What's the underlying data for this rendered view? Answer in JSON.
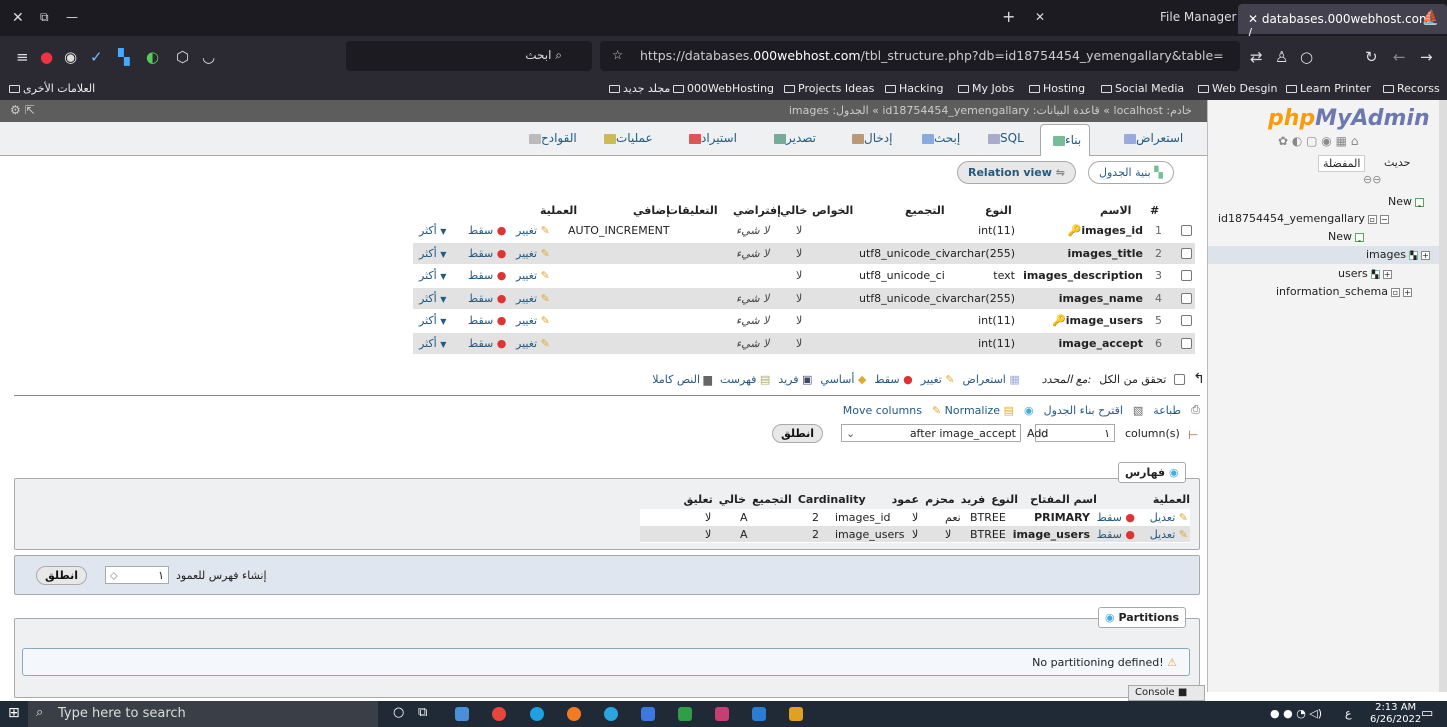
{
  "browser": {
    "active_tab_title": "databases.000webhost.com /",
    "file_manager_tab": "File Manager",
    "url_prefix": "https://databases.",
    "url_domain": "000webhost.com",
    "url_rest": "/tbl_structure.php?db=id18754454_yemengallary&table=",
    "search_placeholder": "ابحث",
    "bookmarks": [
      "مجلد جديد",
      "000WebHosting",
      "Projects Ideas",
      "Hacking",
      "My Jobs",
      "Hosting",
      "Social Media",
      "Web Desgin",
      "Learn Printer",
      "Recorss"
    ],
    "other_bookmarks": "العلامات الأخرى"
  },
  "breadcrumb": "images :الجدول « id18754454_yemengallary :قاعدة البيانات « localhost :خادم",
  "tabs": [
    "استعراض",
    "بناء",
    "SQL",
    "إبحث",
    "إدخال",
    "تصدير",
    "استيراد",
    "عمليات",
    "القوادح"
  ],
  "subtabs": {
    "table_structure": "بنية الجدول",
    "relation_view": "Relation view"
  },
  "sidebar": {
    "logo_php": "php",
    "logo_ma": "MyAdmin",
    "recent": "حديث",
    "favorites": "المفضلة",
    "tree": [
      "New",
      "id18754454_yemengallary",
      "New",
      "images",
      "users",
      "information_schema"
    ]
  },
  "structure": {
    "headers": {
      "num": "#",
      "name": "الاسم",
      "type": "النوع",
      "collation": "التجميع",
      "attributes": "الخواص",
      "null": "خالي",
      "default": "إفتراضي",
      "comments": "التعليقات",
      "extra": "إضافي",
      "action": "العملية"
    },
    "rows": [
      {
        "num": "1",
        "name": "images_id",
        "type": "int(11)",
        "collation": "",
        "null": "لا",
        "default": "لا شيء",
        "extra": "AUTO_INCREMENT"
      },
      {
        "num": "2",
        "name": "images_title",
        "type": "varchar(255)",
        "collation": "utf8_unicode_ci",
        "null": "لا",
        "default": "لا شيء",
        "extra": ""
      },
      {
        "num": "3",
        "name": "images_description",
        "type": "text",
        "collation": "utf8_unicode_ci",
        "null": "لا",
        "default": "",
        "extra": ""
      },
      {
        "num": "4",
        "name": "images_name",
        "type": "varchar(255)",
        "collation": "utf8_unicode_ci",
        "null": "لا",
        "default": "لا شيء",
        "extra": ""
      },
      {
        "num": "5",
        "name": "image_users",
        "type": "int(11)",
        "collation": "",
        "null": "لا",
        "default": "لا شيء",
        "extra": ""
      },
      {
        "num": "6",
        "name": "image_accept",
        "type": "int(11)",
        "collation": "",
        "null": "لا",
        "default": "لا شيء",
        "extra": ""
      }
    ],
    "actions": {
      "edit": "تغيير",
      "drop": "سقط",
      "more": "أكثر"
    }
  },
  "bulk": {
    "check_all": "تحقق من الكل",
    "with_selected": "مع المحدد:",
    "browse": "استعراض",
    "change": "تغيير",
    "drop": "سقط",
    "primary": "أساسي",
    "unique": "فريد",
    "index": "فهرست",
    "fulltext": "النص كاملا"
  },
  "table_tools": {
    "print": "طباعة",
    "propose": "اقترح بناء الجدول",
    "move_columns": "Move columns",
    "normalize": "Normalize",
    "add": "Add",
    "add_count": "١",
    "column_s": "column(s)",
    "after_select": "after image_accept",
    "go": "انطلق"
  },
  "indexes": {
    "legend": "فهارس",
    "headers": {
      "action": "العملية",
      "keyname": "اسم المفتاح",
      "type": "النوع",
      "unique": "فريد",
      "packed": "محزم",
      "column": "عمود",
      "cardinality": "Cardinality",
      "collation": "التجميع",
      "null": "خالي",
      "comment": "تعليق"
    },
    "rows": [
      {
        "edit": "تعديل",
        "drop": "سقط",
        "keyname": "PRIMARY",
        "type": "BTREE",
        "unique": "نعم",
        "packed": "لا",
        "column": "images_id",
        "cardinality": "2",
        "collation": "A",
        "null": "لا"
      },
      {
        "edit": "تعديل",
        "drop": "سقط",
        "keyname": "image_users",
        "type": "BTREE",
        "unique": "لا",
        "packed": "لا",
        "column": "image_users",
        "cardinality": "2",
        "collation": "A",
        "null": "لا"
      }
    ],
    "create_label": "إنشاء فهرس للعمود",
    "create_count": "١",
    "go": "انطلق"
  },
  "partitions": {
    "legend": "Partitions",
    "message": "No partitioning defined!"
  },
  "console": "Console",
  "taskbar": {
    "search": "Type here to search",
    "time": "2:13 AM",
    "date": "6/26/2022",
    "lang": "ع"
  }
}
